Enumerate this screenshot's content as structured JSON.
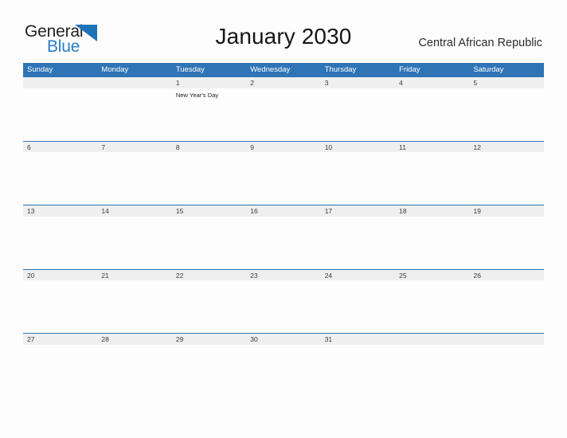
{
  "brand": {
    "name_part1": "General",
    "name_part2": "Blue",
    "triangle_icon": "blue-triangle-icon",
    "colors": {
      "dark": "#231f20",
      "blue": "#2b7cc4"
    }
  },
  "header": {
    "title": "January 2030",
    "country": "Central African Republic"
  },
  "theme": {
    "header_blue": "#2f74b5",
    "row_gray": "#efefef",
    "page_background": "#fdfdfd",
    "date_text": "#3a3a3a"
  },
  "calendar": {
    "weekdays": [
      "Sunday",
      "Monday",
      "Tuesday",
      "Wednesday",
      "Thursday",
      "Friday",
      "Saturday"
    ],
    "weeks": [
      {
        "days": [
          {
            "num": "",
            "event": ""
          },
          {
            "num": "",
            "event": ""
          },
          {
            "num": "1",
            "event": "New Year's Day"
          },
          {
            "num": "2",
            "event": ""
          },
          {
            "num": "3",
            "event": ""
          },
          {
            "num": "4",
            "event": ""
          },
          {
            "num": "5",
            "event": ""
          }
        ]
      },
      {
        "days": [
          {
            "num": "6",
            "event": ""
          },
          {
            "num": "7",
            "event": ""
          },
          {
            "num": "8",
            "event": ""
          },
          {
            "num": "9",
            "event": ""
          },
          {
            "num": "10",
            "event": ""
          },
          {
            "num": "11",
            "event": ""
          },
          {
            "num": "12",
            "event": ""
          }
        ]
      },
      {
        "days": [
          {
            "num": "13",
            "event": ""
          },
          {
            "num": "14",
            "event": ""
          },
          {
            "num": "15",
            "event": ""
          },
          {
            "num": "16",
            "event": ""
          },
          {
            "num": "17",
            "event": ""
          },
          {
            "num": "18",
            "event": ""
          },
          {
            "num": "19",
            "event": ""
          }
        ]
      },
      {
        "days": [
          {
            "num": "20",
            "event": ""
          },
          {
            "num": "21",
            "event": ""
          },
          {
            "num": "22",
            "event": ""
          },
          {
            "num": "23",
            "event": ""
          },
          {
            "num": "24",
            "event": ""
          },
          {
            "num": "25",
            "event": ""
          },
          {
            "num": "26",
            "event": ""
          }
        ]
      },
      {
        "days": [
          {
            "num": "27",
            "event": ""
          },
          {
            "num": "28",
            "event": ""
          },
          {
            "num": "29",
            "event": ""
          },
          {
            "num": "30",
            "event": ""
          },
          {
            "num": "31",
            "event": ""
          },
          {
            "num": "",
            "event": ""
          },
          {
            "num": "",
            "event": ""
          }
        ]
      }
    ]
  }
}
